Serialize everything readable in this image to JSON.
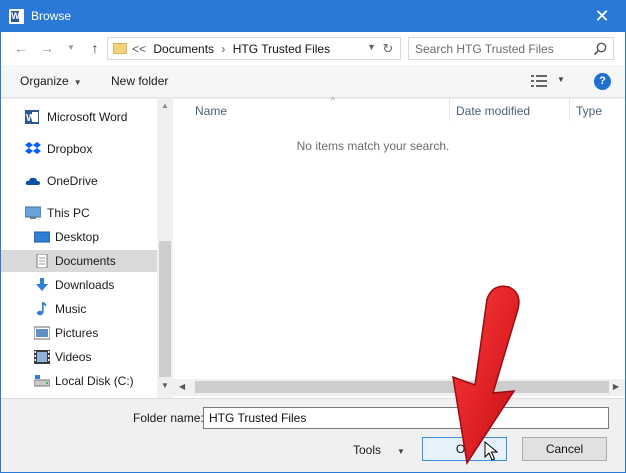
{
  "window": {
    "title": "Browse",
    "app_icon_letter": "W"
  },
  "nav": {
    "address_crumbs": [
      "Documents",
      "HTG Trusted Files"
    ],
    "address_overflow": "<<",
    "search_placeholder": "Search HTG Trusted Files"
  },
  "toolbar": {
    "organize_label": "Organize",
    "new_folder_label": "New folder",
    "help_label": "?"
  },
  "sidebar": {
    "items": [
      {
        "label": "Microsoft Word",
        "icon": "word-icon",
        "selected": false
      },
      {
        "label": "Dropbox",
        "icon": "dropbox-icon",
        "selected": false
      },
      {
        "label": "OneDrive",
        "icon": "onedrive-icon",
        "selected": false
      },
      {
        "label": "This PC",
        "icon": "this-pc-icon",
        "selected": false
      },
      {
        "label": "Desktop",
        "icon": "desktop-icon",
        "selected": false
      },
      {
        "label": "Documents",
        "icon": "documents-icon",
        "selected": true
      },
      {
        "label": "Downloads",
        "icon": "downloads-icon",
        "selected": false
      },
      {
        "label": "Music",
        "icon": "music-icon",
        "selected": false
      },
      {
        "label": "Pictures",
        "icon": "pictures-icon",
        "selected": false
      },
      {
        "label": "Videos",
        "icon": "videos-icon",
        "selected": false
      },
      {
        "label": "Local Disk (C:)",
        "icon": "local-disk-icon",
        "selected": false
      }
    ]
  },
  "content": {
    "columns": [
      "Name",
      "Date modified",
      "Type"
    ],
    "empty_message": "No items match your search."
  },
  "footer": {
    "folder_name_label": "Folder name:",
    "folder_name_value": "HTG Trusted Files",
    "tools_label": "Tools",
    "ok_label": "OK",
    "cancel_label": "Cancel"
  },
  "colors": {
    "title_bar": "#2b79d6",
    "selected_item": "#d9d9d9",
    "annotation_arrow": "#e3101e",
    "help_icon": "#1f6fd1"
  }
}
